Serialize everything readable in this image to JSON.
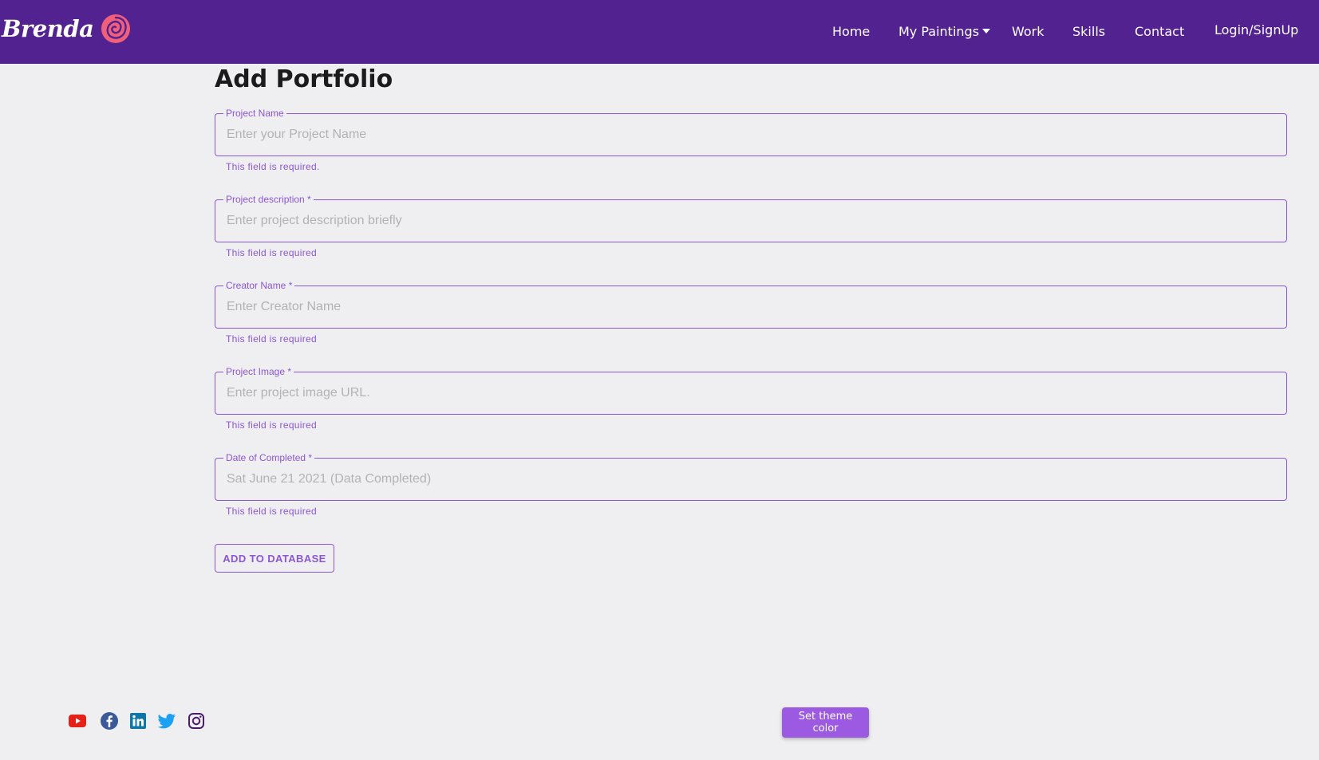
{
  "brand": {
    "name": "Brenda",
    "logo_icon": "rose-logo-icon"
  },
  "nav": {
    "home": "Home",
    "my_paintings": "My Paintings",
    "work": "Work",
    "skills": "Skills",
    "contact": "Contact",
    "login": "Login/SignUp"
  },
  "page": {
    "title": "Add Portfolio"
  },
  "form": {
    "fields": [
      {
        "label": "Project Name",
        "placeholder": "Enter your Project Name",
        "helper": "This field is required."
      },
      {
        "label": "Project description *",
        "placeholder": "Enter project description briefly",
        "helper": "This field is required"
      },
      {
        "label": "Creator Name *",
        "placeholder": "Enter Creator Name",
        "helper": "This field is required"
      },
      {
        "label": "Project Image *",
        "placeholder": "Enter project image URL.",
        "helper": "This field is required"
      },
      {
        "label": "Date of Completed *",
        "placeholder": "Sat June 21 2021 (Data Completed)",
        "helper": "This field is required"
      }
    ],
    "submit_label": "ADD TO DATABASE"
  },
  "footer": {
    "social_icons": [
      "youtube-icon",
      "facebook-icon",
      "linkedin-icon",
      "twitter-icon",
      "instagram-icon"
    ],
    "theme_button": "Set theme color"
  },
  "colors": {
    "navbar": "#522290",
    "accent": "#8a57d6",
    "background": "#efeef0",
    "theme_button": "#9b5ae1",
    "logo": "#f0607a"
  }
}
